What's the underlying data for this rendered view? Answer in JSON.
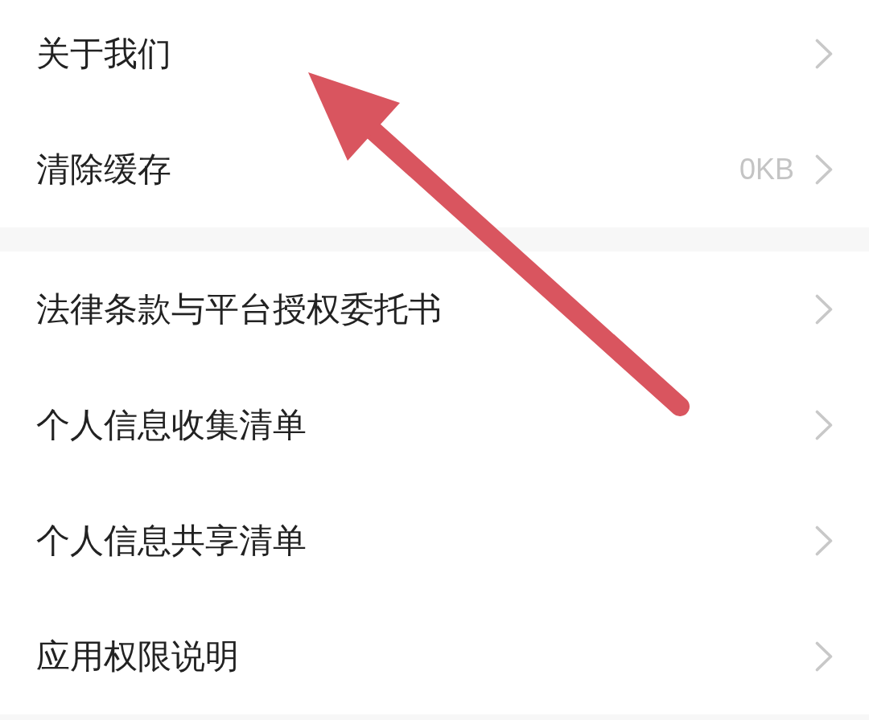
{
  "sections": [
    {
      "items": [
        {
          "label": "关于我们"
        },
        {
          "label": "清除缓存",
          "value": "0KB"
        }
      ]
    },
    {
      "items": [
        {
          "label": "法律条款与平台授权委托书"
        },
        {
          "label": "个人信息收集清单"
        },
        {
          "label": "个人信息共享清单"
        },
        {
          "label": "应用权限说明"
        }
      ]
    }
  ]
}
